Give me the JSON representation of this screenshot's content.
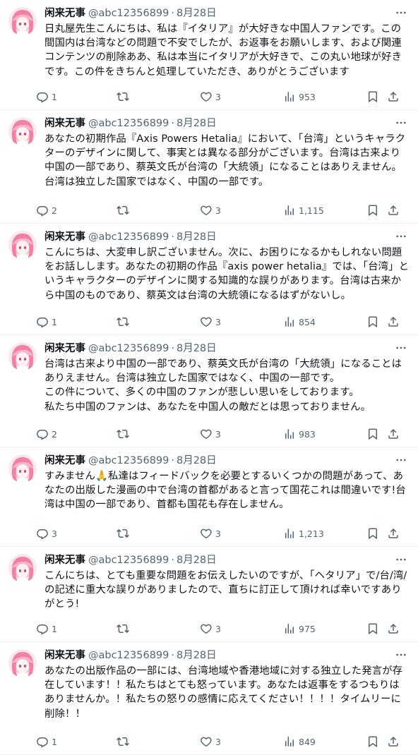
{
  "tweets": [
    {
      "name": "闲来无事",
      "handle": "@abc12356899",
      "separator": "·",
      "date": "8月28日",
      "text": "日丸屋先生こんにちは、私は『イタリア』が大好きな中国人ファンです。この間国内は台湾などの問題で不安でしたが、お返事をお願いします、および関連コンテンツの削除ああ、私は本当にイタリアが大好きで、この丸い地球が好きです。この件をきちんと処理していただき、ありがとうございます",
      "replies": "1",
      "retweets": "",
      "likes": "3",
      "views": "953"
    },
    {
      "name": "闲来无事",
      "handle": "@abc12356899",
      "separator": "·",
      "date": "8月28日",
      "text": "あなたの初期作品『Axis Powers Hetalia』において、「台湾」というキャラクターのデザインに関して、事実とは異なる部分がございます。台湾は古来より中国の一部であり、蔡英文氏が台湾の「大統領」になることはありえません。台湾は独立した国家ではなく、中国の一部です。",
      "replies": "2",
      "retweets": "",
      "likes": "3",
      "views": "1,115"
    },
    {
      "name": "闲来无事",
      "handle": "@abc12356899",
      "separator": "·",
      "date": "8月28日",
      "text": "こんにちは、大変申し訳ございません。次に、お困りになるかもしれない問題をお話しします。あなたの初期の作品『axis power hetalia』では、「台湾」というキャラクターのデザインに関する知識的な誤りがあります。台湾は古来から中国のものであり、蔡英文は台湾の大統領になるはずがないし。",
      "replies": "1",
      "retweets": "",
      "likes": "3",
      "views": "854"
    },
    {
      "name": "闲来无事",
      "handle": "@abc12356899",
      "separator": "·",
      "date": "8月28日",
      "text": "台湾は古来より中国の一部であり、蔡英文氏が台湾の「大統領」になることはありえません。台湾は独立した国家ではなく、中国の一部です。\nこの件について、多くの中国のファンが悲しい思いをしております。\n私たち中国のファンは、あなたを中国人の敵だとは思っておりません。",
      "replies": "2",
      "retweets": "",
      "likes": "3",
      "views": "983"
    },
    {
      "name": "闲来无事",
      "handle": "@abc12356899",
      "separator": "·",
      "date": "8月28日",
      "text": "すみません🙏私達はフィードバックを必要とするいくつかの問題があって、あなたの出版した漫画の中で台湾の首都があると言って国花これは間違いです!台湾は中国の一部であり、首都も国花も存在しません。",
      "replies": "3",
      "retweets": "",
      "likes": "3",
      "views": "1,213"
    },
    {
      "name": "闲来无事",
      "handle": "@abc12356899",
      "separator": "·",
      "date": "8月28日",
      "text": "こんにちは、とても重要な問題をお伝えしたいのですが、「ヘタリア」で/台/湾/の記述に重大な誤りがありましたので、直ちに訂正して頂ければ幸いですありがとう!",
      "replies": "1",
      "retweets": "",
      "likes": "3",
      "views": "975"
    },
    {
      "name": "闲来无事",
      "handle": "@abc12356899",
      "separator": "·",
      "date": "8月28日",
      "text": "あなたの出版作品の一部には、台湾地域や香港地域に対する独立した発言が存在しています！！私たちはとても怒っています。あなたは返事をするつもりはありませんか。！私たちの怒りの感情に応えてください！！！！タイムリーに削除！！",
      "replies": "1",
      "retweets": "",
      "likes": "3",
      "views": "849"
    }
  ],
  "icons": {
    "reply": "reply-icon",
    "retweet": "retweet-icon",
    "like": "heart-icon",
    "views": "views-icon",
    "bookmark": "bookmark-icon",
    "share": "share-icon",
    "more": "more-icon"
  },
  "colors": {
    "text": "#0f1419",
    "secondary": "#536471",
    "divider": "#eff3f4",
    "avatar_pink": "#f6b5c9",
    "avatar_hair": "#f27fa5"
  }
}
